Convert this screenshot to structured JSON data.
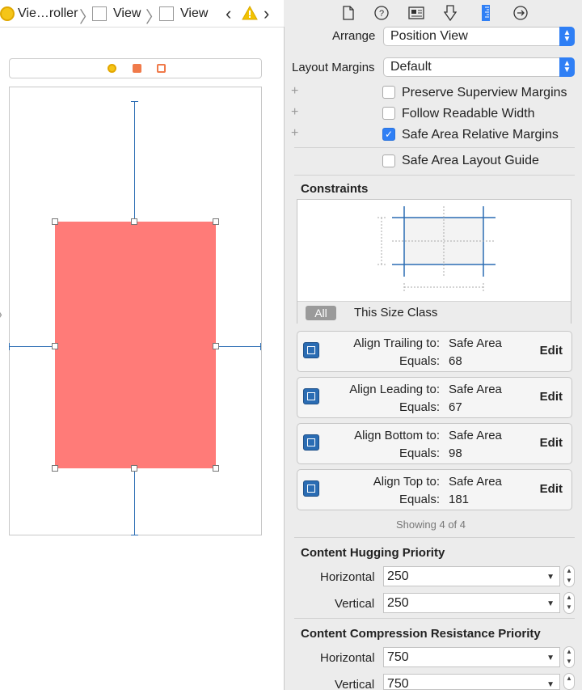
{
  "jumpbar": {
    "items": [
      {
        "label": "Vie…roller",
        "icon": "view-controller-icon"
      },
      {
        "label": "View",
        "icon": "view-icon"
      },
      {
        "label": "View",
        "icon": "view-icon"
      }
    ],
    "back_symbol": "‹",
    "forward_symbol": "›",
    "warning_icon": "warning-icon"
  },
  "inspector_tabs": [
    "file-icon",
    "help-icon",
    "identity-icon",
    "attributes-icon",
    "size-ruler-icon",
    "connections-icon"
  ],
  "view_section": {
    "arrange_label": "Arrange",
    "arrange_value": "Position View",
    "layout_margins_label": "Layout Margins",
    "layout_margins_value": "Default",
    "checkboxes": [
      {
        "label": "Preserve Superview Margins",
        "checked": false
      },
      {
        "label": "Follow Readable Width",
        "checked": false
      },
      {
        "label": "Safe Area Relative Margins",
        "checked": true
      }
    ],
    "safe_area_guide": {
      "label": "Safe Area Layout Guide",
      "checked": false
    }
  },
  "constraints": {
    "title": "Constraints",
    "filter_all": "All",
    "filter_size_class": "This Size Class",
    "items": [
      {
        "label": "Align Trailing to:",
        "target": "Safe Area",
        "equals_label": "Equals:",
        "value": "68",
        "edit": "Edit",
        "icon": "align-trailing-icon"
      },
      {
        "label": "Align Leading to:",
        "target": "Safe Area",
        "equals_label": "Equals:",
        "value": "67",
        "edit": "Edit",
        "icon": "align-leading-icon"
      },
      {
        "label": "Align Bottom to:",
        "target": "Safe Area",
        "equals_label": "Equals:",
        "value": "98",
        "edit": "Edit",
        "icon": "align-bottom-icon"
      },
      {
        "label": "Align Top to:",
        "target": "Safe Area",
        "equals_label": "Equals:",
        "value": "181",
        "edit": "Edit",
        "icon": "align-top-icon"
      }
    ],
    "showing": "Showing 4 of 4"
  },
  "hugging": {
    "title": "Content Hugging Priority",
    "horizontal_label": "Horizontal",
    "horizontal_value": "250",
    "vertical_label": "Vertical",
    "vertical_value": "250"
  },
  "compression": {
    "title": "Content Compression Resistance Priority",
    "horizontal_label": "Horizontal",
    "horizontal_value": "750",
    "vertical_label": "Vertical",
    "vertical_value": "750"
  },
  "colors": {
    "selected_view": "#ff7b78",
    "constraint_line": "#2a6cb3",
    "accent": "#2f7ff5"
  }
}
